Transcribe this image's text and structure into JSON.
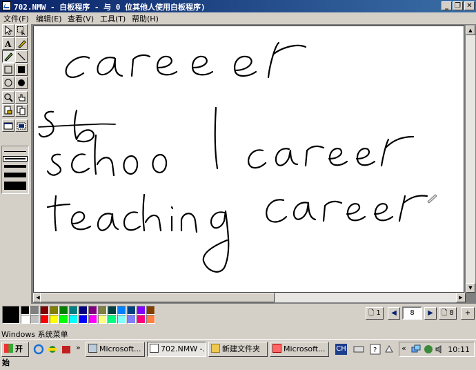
{
  "window": {
    "title": "702.NMW - 白板程序 - 与 0 位其他人使用白板程序)",
    "minimize_label": "_",
    "restore_label": "❐",
    "close_label": "✕"
  },
  "menu": [
    {
      "label": "文件(F)"
    },
    {
      "label": "编辑(E)"
    },
    {
      "label": "查看(V)"
    },
    {
      "label": "工具(T)"
    },
    {
      "label": "帮助(H)"
    }
  ],
  "tools": [
    "select-arrow",
    "select-area",
    "text",
    "highlighter",
    "pen",
    "line",
    "rect-outline",
    "rect-filled",
    "ellipse-outline",
    "ellipse-filled",
    "zoom",
    "remote-pointer",
    "lock-contents",
    "sync",
    "select-window",
    "select-area-capture"
  ],
  "canvas_text": {
    "line1": "career",
    "line2": "sb",
    "line3": "school career",
    "line4": "teaching career"
  },
  "palette": {
    "current_fg": "#000000",
    "colors": [
      "#000000",
      "#808080",
      "#800000",
      "#808000",
      "#008000",
      "#008080",
      "#000080",
      "#800080",
      "#808040",
      "#004040",
      "#0080ff",
      "#004080",
      "#8000ff",
      "#804000",
      "#ffffff",
      "#c0c0c0",
      "#ff0000",
      "#ffff00",
      "#00ff00",
      "#00ffff",
      "#0000ff",
      "#ff00ff",
      "#ffff80",
      "#00ff80",
      "#80ffff",
      "#8080ff",
      "#ff0080",
      "#ff8040"
    ]
  },
  "pager": {
    "first_page": "1",
    "current_page": "8",
    "last_page": "8",
    "add_page": "+"
  },
  "status": {
    "text": "Windows 系统菜单"
  },
  "taskbar": {
    "start_label": "开始",
    "buttons": [
      {
        "label": "Microsoft..."
      },
      {
        "label": "702.NMW -..."
      },
      {
        "label": "新建文件夹"
      },
      {
        "label": "Microsoft..."
      }
    ],
    "ime": "CH",
    "clock": "10:11"
  }
}
